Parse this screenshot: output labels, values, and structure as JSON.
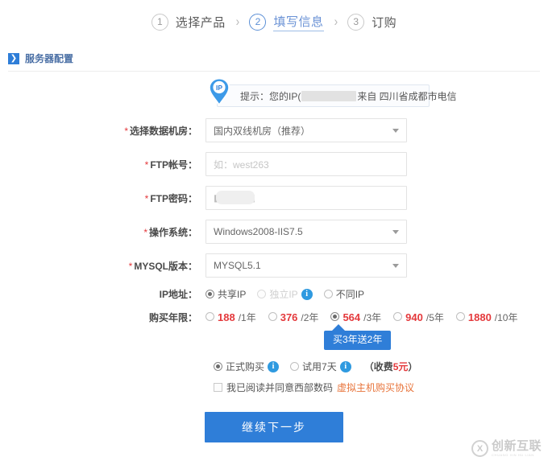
{
  "steps": [
    {
      "num": "1",
      "label": "选择产品",
      "active": false
    },
    {
      "num": "2",
      "label": "填写信息",
      "active": true
    },
    {
      "num": "3",
      "label": "订购",
      "active": false
    }
  ],
  "step_separator": "›",
  "section": {
    "arrow_icon": "chevron-right-icon",
    "title": "服务器配置"
  },
  "ip_tip": {
    "badge": "IP",
    "prefix": "提示：您的IP(",
    "redacted": "",
    "suffix": "来自 四川省成都市电信"
  },
  "form": {
    "datacenter": {
      "required": "*",
      "label": "选择数据机房：",
      "value": "国内双线机房（推荐）",
      "options": [
        "国内双线机房（推荐）"
      ]
    },
    "ftp_user": {
      "required": "*",
      "label": "FTP帐号：",
      "value": "",
      "placeholder": "如：west263"
    },
    "ftp_pass": {
      "required": "*",
      "label": "FTP密码：",
      "value": "",
      "masked": true
    },
    "os": {
      "required": "*",
      "label": "操作系统：",
      "value": "Windows2008-IIS7.5",
      "options": [
        "Windows2008-IIS7.5"
      ]
    },
    "mysql": {
      "required": "*",
      "label": "MYSQL版本：",
      "value": "MYSQL5.1",
      "options": [
        "MYSQL5.1"
      ]
    },
    "ip_address": {
      "label": "IP地址：",
      "options": [
        {
          "label": "共享IP",
          "selected": true,
          "disabled": false,
          "info": false
        },
        {
          "label": "独立IP",
          "selected": false,
          "disabled": true,
          "info": true
        },
        {
          "label": "不同IP",
          "selected": false,
          "disabled": false,
          "info": false
        }
      ]
    },
    "term": {
      "label": "购买年限：",
      "options": [
        {
          "price": "188",
          "unit": "/1年",
          "selected": false
        },
        {
          "price": "376",
          "unit": "/2年",
          "selected": false
        },
        {
          "price": "564",
          "unit": "/3年",
          "selected": true
        },
        {
          "price": "940",
          "unit": "/5年",
          "selected": false
        },
        {
          "price": "1880",
          "unit": "/10年",
          "selected": false
        }
      ]
    },
    "tooltip": "买3年送2年",
    "purchase_type": {
      "options": [
        {
          "label": "正式购买",
          "selected": true,
          "info": true
        },
        {
          "label": "试用7天",
          "selected": false,
          "info": true
        }
      ],
      "note_open": "（收费",
      "note_amount": "5元",
      "note_close": "）"
    },
    "agreement": {
      "checked": false,
      "text": "我已阅读并同意西部数码",
      "link": "虚拟主机购买协议"
    }
  },
  "submit_label": "继续下一步",
  "watermark": {
    "mark": "X",
    "cn": "创新互联",
    "en": "CHUANG XIN HU LIAN"
  },
  "colors": {
    "primary": "#2f7ed8",
    "price": "#e4393c",
    "link": "#e8743b",
    "info": "#2f9ae0"
  }
}
